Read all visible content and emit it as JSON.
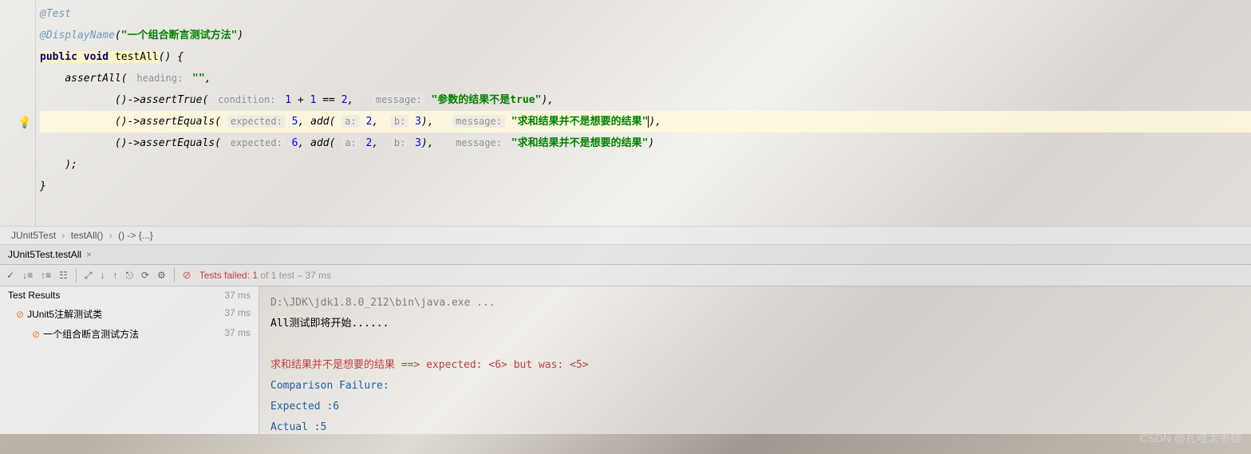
{
  "code": {
    "annotation_test": "@Test",
    "annotation_display": "@DisplayName",
    "display_name_value": "\"一个组合断言测试方法\"",
    "public": "public",
    "void": "void",
    "method_name": "testAll",
    "assertAll": "assertAll",
    "heading_hint": "heading:",
    "heading_value": "\"\"",
    "assertTrue": "assertTrue",
    "assertEquals": "assertEquals",
    "condition_hint": "condition:",
    "expr": "1 + 1 == 2",
    "message_hint": "message:",
    "msg1": "\"参数的结果不是true\"",
    "expected_hint": "expected:",
    "exp5": "5",
    "exp6": "6",
    "add": "add",
    "a_hint": "a:",
    "a_val": "2",
    "b_hint": "b:",
    "b_val": "3",
    "msg2": "\"求和结果并不是想要的结果\"",
    "msg3": "\"求和结果并不是想要的结果\""
  },
  "breadcrumb": {
    "class": "JUnit5Test",
    "method": "testAll()",
    "lambda": "() -> {...}"
  },
  "run_tab": "JUnit5Test.testAll",
  "test_status": {
    "label": "Tests failed: 1",
    "suffix": " of 1 test – 37 ms"
  },
  "tree": {
    "header": "Test Results",
    "header_time": "37 ms",
    "node1": "JUnit5注解测试类",
    "node1_time": "37 ms",
    "node2": "一个组合断言测试方法",
    "node2_time": "37 ms"
  },
  "console": {
    "path": "D:\\JDK\\jdk1.8.0_212\\bin\\java.exe ...",
    "line1": "All测试即将开始......",
    "error": "求和结果并不是想要的结果 ==> expected: <6> but was: <5>",
    "comp": "Comparison Failure: ",
    "expected": "Expected :6",
    "actual": "Actual   :5"
  },
  "watermark": "CSDN @扎哇太枣糕"
}
